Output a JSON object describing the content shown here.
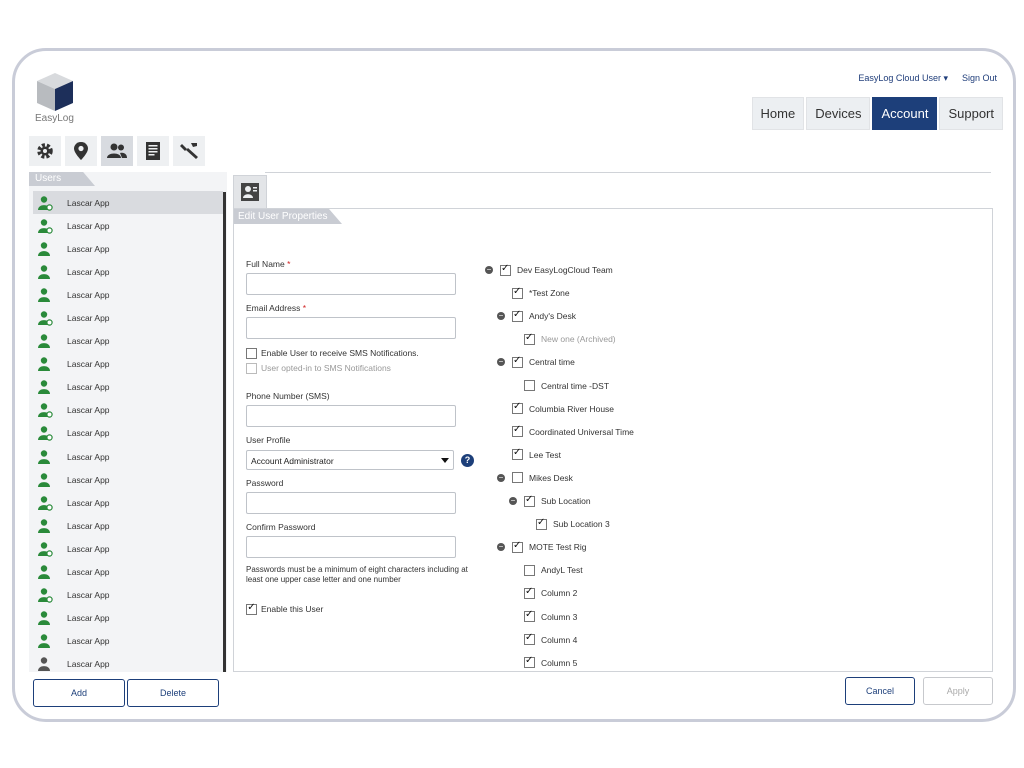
{
  "header": {
    "logo_text": "EasyLog",
    "user_menu": "EasyLog Cloud User ▾",
    "sign_out": "Sign Out",
    "nav": [
      "Home",
      "Devices",
      "Account",
      "Support"
    ],
    "nav_active": "Account"
  },
  "toolbar": {
    "icons": [
      "gear-icon",
      "location-pin-icon",
      "users-icon",
      "document-icon",
      "wrench-icon"
    ],
    "active": "users-icon"
  },
  "users": {
    "title": "Users",
    "items": [
      "Lascar App",
      "Lascar App",
      "Lascar App",
      "Lascar App",
      "Lascar App",
      "Lascar App",
      "Lascar App",
      "Lascar App",
      "Lascar App",
      "Lascar App",
      "Lascar App",
      "Lascar App",
      "Lascar App",
      "Lascar App",
      "Lascar App",
      "Lascar App",
      "Lascar App",
      "Lascar App",
      "Lascar App",
      "Lascar App",
      "Lascar App"
    ],
    "add_label": "Add",
    "delete_label": "Delete"
  },
  "form": {
    "title": "Edit User Properties",
    "full_name_label": "Full Name",
    "full_name_value": "",
    "email_label": "Email Address",
    "email_value": "",
    "required_mark": "*",
    "sms_enable_label": "Enable User to receive SMS Notifications.",
    "sms_optin_label": "User opted-in to SMS Notifications",
    "phone_label": "Phone Number (SMS)",
    "phone_value": "",
    "profile_label": "User Profile",
    "profile_value": "Account Administrator",
    "help_glyph": "?",
    "password_label": "Password",
    "confirm_label": "Confirm Password",
    "password_note": "Passwords must be a minimum of eight characters including at least one upper case letter and one number",
    "enable_user_label": "Enable this User",
    "enable_user_checked": true
  },
  "tree": [
    {
      "label": "Dev EasyLogCloud Team",
      "checked": true,
      "collapsible": true
    },
    {
      "label": "*Test Zone",
      "checked": true,
      "collapsible": false
    },
    {
      "label": "Andy's Desk",
      "checked": true,
      "collapsible": true
    },
    {
      "label": "New one (Archived)",
      "checked": true,
      "collapsible": false,
      "disabled": true
    },
    {
      "label": "Central time",
      "checked": true,
      "collapsible": true
    },
    {
      "label": "Central time -DST",
      "checked": false,
      "collapsible": false
    },
    {
      "label": "Columbia River House",
      "checked": true,
      "collapsible": false
    },
    {
      "label": "Coordinated Universal Time",
      "checked": true,
      "collapsible": false
    },
    {
      "label": "Lee Test",
      "checked": true,
      "collapsible": false
    },
    {
      "label": "Mikes Desk",
      "checked": false,
      "collapsible": true
    },
    {
      "label": "Sub Location",
      "checked": true,
      "collapsible": true
    },
    {
      "label": "Sub Location 3",
      "checked": true,
      "collapsible": false
    },
    {
      "label": "MOTE Test Rig",
      "checked": true,
      "collapsible": true
    },
    {
      "label": "AndyL Test",
      "checked": false,
      "collapsible": false
    },
    {
      "label": "Column 2",
      "checked": true,
      "collapsible": false
    },
    {
      "label": "Column 3",
      "checked": true,
      "collapsible": false
    },
    {
      "label": "Column 4",
      "checked": true,
      "collapsible": false
    },
    {
      "label": "Column 5",
      "checked": true,
      "collapsible": false
    }
  ],
  "actions": {
    "cancel_label": "Cancel",
    "apply_label": "Apply"
  },
  "colors": {
    "brand": "#1d3f7a",
    "user_icon_green": "#2a8a3a",
    "user_icon_grey": "#555555"
  }
}
